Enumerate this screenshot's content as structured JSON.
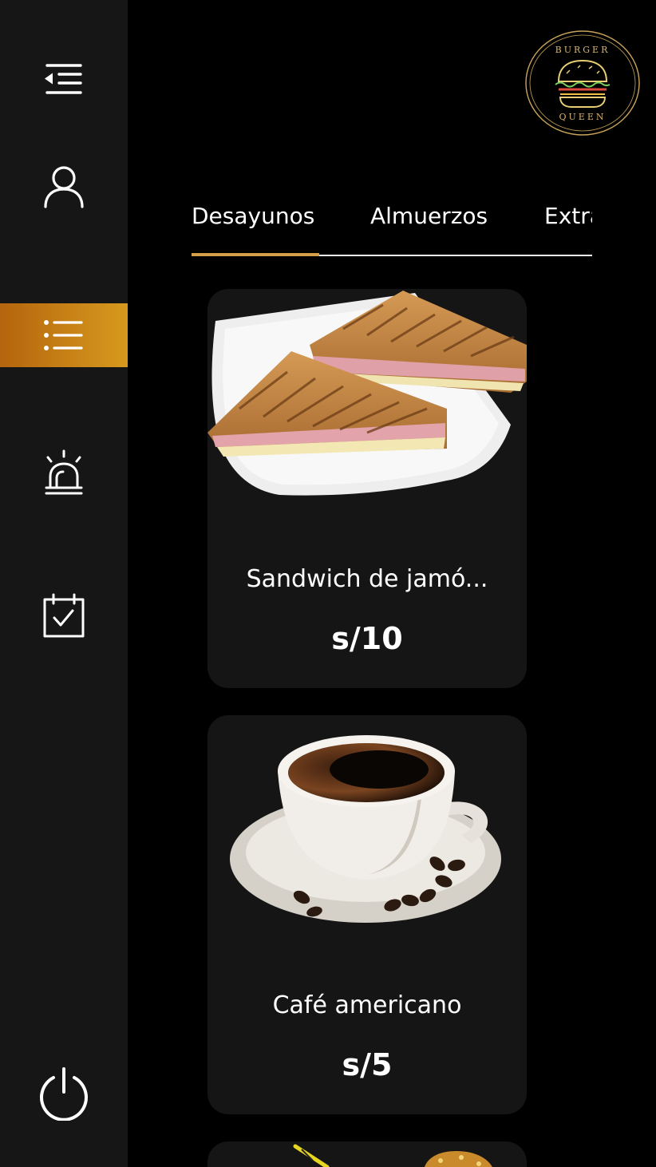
{
  "sidebar": {
    "items": [
      {
        "icon": "collapse-menu-icon"
      },
      {
        "icon": "user-icon"
      },
      {
        "icon": "list-icon",
        "active": true
      },
      {
        "icon": "alarm-light-icon"
      },
      {
        "icon": "calendar-check-icon"
      },
      {
        "icon": "power-icon"
      }
    ]
  },
  "logo": {
    "top": "BURGER",
    "bottom": "QUEEN"
  },
  "tabs": [
    {
      "label": "Desayunos",
      "selected": true
    },
    {
      "label": "Almuerzos",
      "selected": false
    },
    {
      "label": "Extras",
      "selected": false
    }
  ],
  "products": [
    {
      "name": "Sandwich de jamó...",
      "price": "s/10",
      "image": "sandwich-image"
    },
    {
      "name": "Café americano",
      "price": "s/5",
      "image": "coffee-cup-image"
    }
  ],
  "colors": {
    "accent": "#d6a049",
    "sidebar": "#161616",
    "card": "#151515",
    "background": "#000000"
  }
}
